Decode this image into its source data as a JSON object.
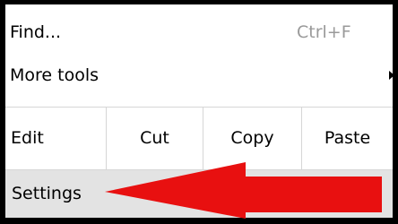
{
  "menu": {
    "find": {
      "label": "Find...",
      "shortcut": "Ctrl+F"
    },
    "more_tools": {
      "label": "More tools",
      "submenu_icon": "chevron-right-icon"
    },
    "edit_row": {
      "label": "Edit",
      "cut": "Cut",
      "copy": "Copy",
      "paste": "Paste"
    },
    "settings": {
      "label": "Settings"
    }
  },
  "annotation": {
    "arrow_icon": "red-arrow-pointer",
    "color": "#e81010"
  }
}
